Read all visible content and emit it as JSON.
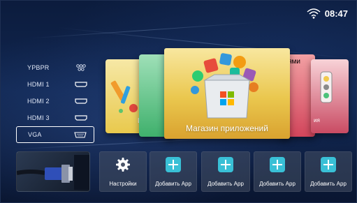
{
  "status": {
    "time": "08:47",
    "wifi_icon": "wifi-icon"
  },
  "sources": [
    {
      "label": "YPBPR",
      "icon": "ypbpr-icon"
    },
    {
      "label": "HDMI 1",
      "icon": "hdmi-icon"
    },
    {
      "label": "HDMI 2",
      "icon": "hdmi-icon"
    },
    {
      "label": "HDMI 3",
      "icon": "hdmi-icon"
    },
    {
      "label": "VGA",
      "icon": "vga-icon",
      "selected": true
    }
  ],
  "carousel": {
    "center": {
      "label": "Магазин приложений"
    },
    "left_partial": {
      "label": "И"
    },
    "right_partial": {
      "label": "ниями"
    },
    "right_far": {
      "label": "ия"
    }
  },
  "bottom": {
    "settings": {
      "label": "Настройки",
      "icon": "gear-icon"
    },
    "add_apps": [
      {
        "label": "Добавить App"
      },
      {
        "label": "Добавить App"
      },
      {
        "label": "Добавить App"
      },
      {
        "label": "Добавить App"
      }
    ]
  },
  "colors": {
    "accent": "#39c0d6",
    "background": "#0c1c3d"
  }
}
